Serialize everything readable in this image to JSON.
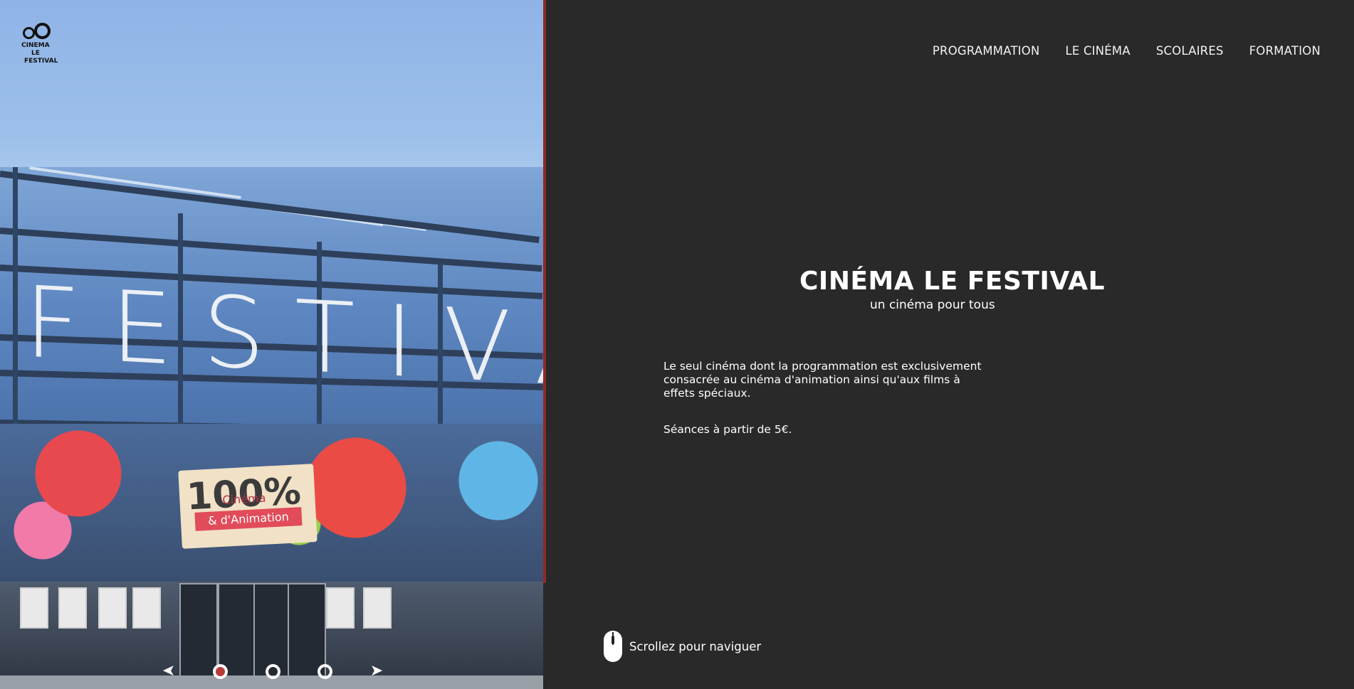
{
  "logo": {
    "lines": [
      "CINEMA",
      "LE",
      "FESTIVAL"
    ]
  },
  "hero": {
    "facade_text": "FESTIVAL",
    "sign_main": "100%",
    "sign_line1": "Cinéma",
    "sign_line2": "& d'Animation",
    "slider": {
      "prev_icon": "arrow-left-icon",
      "next_icon": "arrow-right-icon",
      "active_index": 0,
      "count": 3
    }
  },
  "nav": {
    "items": [
      "PROGRAMMATION",
      "LE CINÉMA",
      "SCOLAIRES",
      "FORMATION"
    ]
  },
  "main": {
    "title": "CINÉMA LE FESTIVAL",
    "subtitle": "un cinéma pour tous",
    "description": "Le seul cinéma dont la programmation est exclusivement consacrée au cinéma d'animation ainsi qu'aux films à effets spéciaux.",
    "price": "Séances à partir de 5€."
  },
  "scroll_hint": {
    "icon": "mouse-icon",
    "label": "Scrollez pour naviguer"
  },
  "colors": {
    "background": "#292929",
    "accent": "#b93c3c",
    "text": "#ffffff"
  }
}
